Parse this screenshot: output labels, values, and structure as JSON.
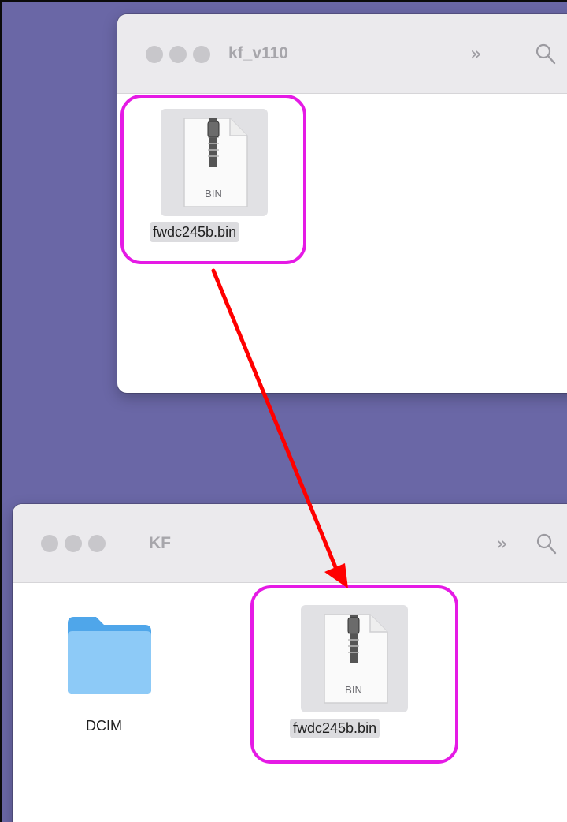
{
  "top_window": {
    "title": "kf_v110",
    "chevron": "»",
    "search_icon": "search-icon",
    "file": {
      "name": "fwdc245b.bin",
      "badge": "BIN",
      "icon": "zip-archive-file-icon"
    }
  },
  "bottom_window": {
    "title": "KF",
    "chevron": "»",
    "search_icon": "search-icon",
    "folder": {
      "name": "DCIM",
      "icon": "folder-icon",
      "color": "#5fb3ef"
    },
    "file": {
      "name": "fwdc245b.bin",
      "badge": "BIN",
      "icon": "zip-archive-file-icon"
    }
  },
  "annotation": {
    "highlight_color": "#e51ae5",
    "arrow_color": "#ff0000"
  }
}
